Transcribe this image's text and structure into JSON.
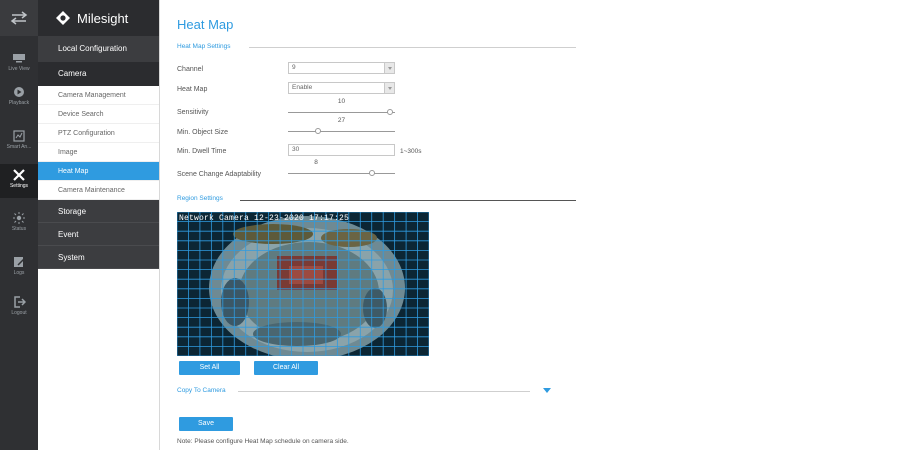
{
  "rail": {
    "items": [
      {
        "id": "live-view",
        "label": "Live View",
        "icon": "monitor-icon"
      },
      {
        "id": "playback",
        "label": "Playback",
        "icon": "playback-icon"
      },
      {
        "id": "smart-analysis",
        "label": "Smart An...",
        "icon": "chart-icon"
      },
      {
        "id": "settings",
        "label": "Settings",
        "icon": "wrench-cross-icon",
        "active": true
      },
      {
        "id": "status",
        "label": "Status",
        "icon": "sun-icon"
      },
      {
        "id": "logs",
        "label": "Logs",
        "icon": "edit-icon"
      },
      {
        "id": "logout",
        "label": "Logout",
        "icon": "logout-icon"
      }
    ]
  },
  "brand": {
    "name": "Milesight"
  },
  "nav": {
    "local_config": "Local Configuration",
    "camera": "Camera",
    "camera_items": [
      {
        "label": "Camera Management"
      },
      {
        "label": "Device Search"
      },
      {
        "label": "PTZ Configuration"
      },
      {
        "label": "Image"
      },
      {
        "label": "Heat Map",
        "active": true
      },
      {
        "label": "Camera Maintenance"
      }
    ],
    "storage": "Storage",
    "event": "Event",
    "system": "System"
  },
  "page": {
    "title": "Heat Map",
    "heat_map_settings": "Heat Map Settings",
    "region_settings": "Region Settings",
    "copy_to_camera": "Copy To Camera",
    "note": "Note: Please configure Heat Map schedule on camera side."
  },
  "form": {
    "channel": {
      "label": "Channel",
      "value": "9"
    },
    "heat_map": {
      "label": "Heat Map",
      "value": "Enable"
    },
    "sensitivity": {
      "label": "Sensitivity",
      "value": "10",
      "fraction": 0.98
    },
    "min_object_size": {
      "label": "Min. Object Size",
      "value": "27",
      "fraction": 0.27
    },
    "min_dwell_time": {
      "label": "Min. Dwell Time",
      "value": "30",
      "hint": "1~300s"
    },
    "scene_change": {
      "label": "Scene Change Adaptability",
      "value": "8",
      "fraction": 0.8
    }
  },
  "video": {
    "osd": "Network Camera     12-23-2020 17:17:25"
  },
  "buttons": {
    "set_all": "Set All",
    "clear_all": "Clear All",
    "save": "Save"
  },
  "colors": {
    "accent": "#2f9be0",
    "rail_bg": "#2f3033",
    "grid_line": "#2f9be0"
  }
}
